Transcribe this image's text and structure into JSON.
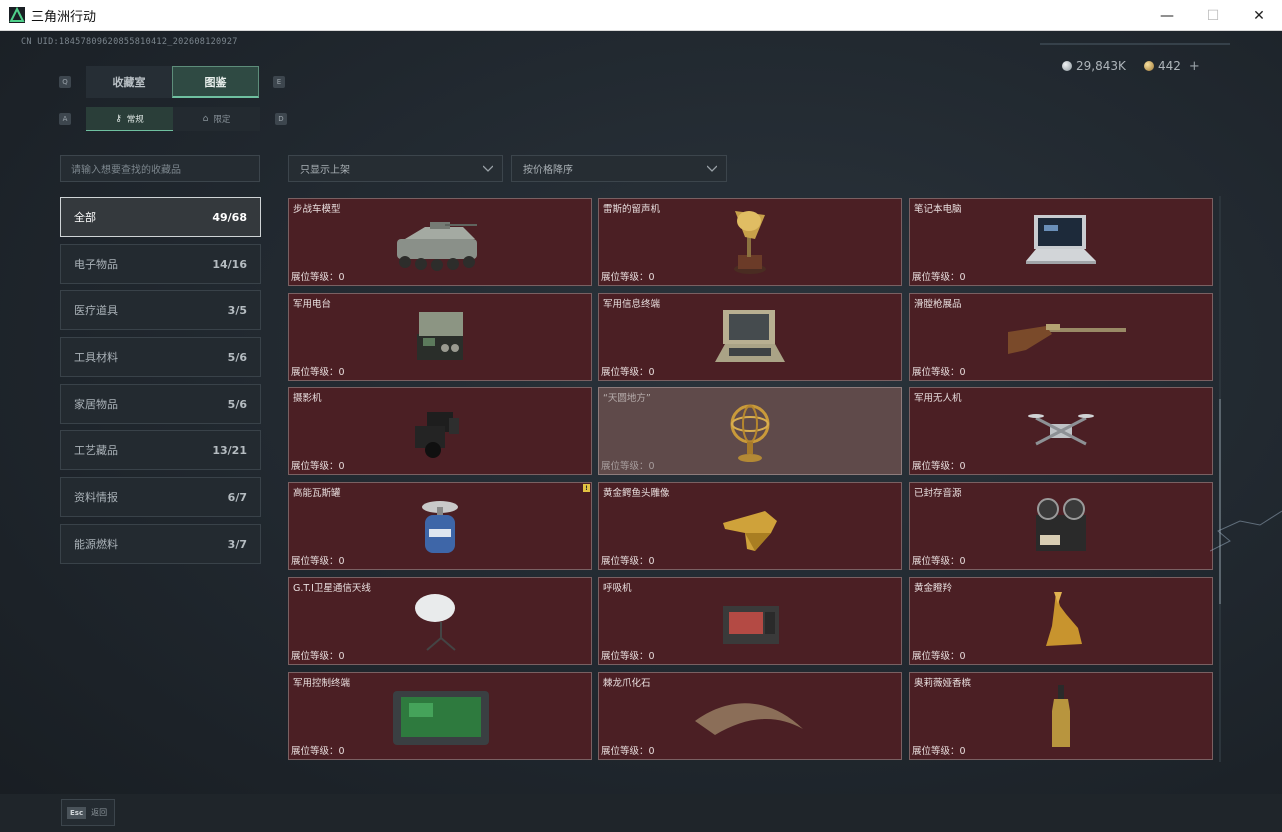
{
  "window": {
    "title": "三角洲行动",
    "min": "—",
    "max": "☐",
    "close": "✕"
  },
  "uid": "CN UID:18457809620855810412_202608120927",
  "currency": [
    {
      "value": "29,843K",
      "color": "#c7cfd3"
    },
    {
      "value": "442",
      "color": "#d9b46a",
      "plus": "+"
    }
  ],
  "keys": {
    "q": "Q",
    "e": "E",
    "a": "A",
    "d": "D"
  },
  "tabs": {
    "collection": "收藏室",
    "codex": "图鉴"
  },
  "subtabs": {
    "normal": "常规",
    "limited": "限定"
  },
  "search_placeholder": "请输入想要查找的收藏品",
  "filters": {
    "shelf": "只显示上架",
    "sort": "按价格降序"
  },
  "categories": [
    {
      "label": "全部",
      "count": "49/68",
      "active": true
    },
    {
      "label": "电子物品",
      "count": "14/16"
    },
    {
      "label": "医疗道具",
      "count": "3/5"
    },
    {
      "label": "工具材料",
      "count": "5/6"
    },
    {
      "label": "家居物品",
      "count": "5/6"
    },
    {
      "label": "工艺藏品",
      "count": "13/21"
    },
    {
      "label": "资料情报",
      "count": "6/7"
    },
    {
      "label": "能源燃料",
      "count": "3/7"
    }
  ],
  "items": [
    {
      "name": "步战车模型",
      "level": "展位等级：0",
      "icon": "ifv-model-icon"
    },
    {
      "name": "雷斯的留声机",
      "level": "展位等级：0",
      "icon": "gramophone-icon"
    },
    {
      "name": "笔记本电脑",
      "level": "展位等级：0",
      "icon": "laptop-icon"
    },
    {
      "name": "军用电台",
      "level": "展位等级：0",
      "icon": "radio-icon"
    },
    {
      "name": "军用信息终端",
      "level": "展位等级：0",
      "icon": "terminal-icon"
    },
    {
      "name": "滑膛枪展品",
      "level": "展位等级：0",
      "icon": "musket-icon"
    },
    {
      "name": "摄影机",
      "level": "展位等级：0",
      "icon": "camera-icon"
    },
    {
      "name": "“天圆地方”",
      "level": "展位等级：0",
      "icon": "armillary-icon",
      "highlight": true
    },
    {
      "name": "军用无人机",
      "level": "展位等级：0",
      "icon": "drone-icon"
    },
    {
      "name": "高能瓦斯罐",
      "level": "展位等级：0",
      "icon": "gas-tank-icon",
      "badge": "!"
    },
    {
      "name": "黄金鳄鱼头雕像",
      "level": "展位等级：0",
      "icon": "croc-head-icon"
    },
    {
      "name": "已封存音源",
      "level": "展位等级：0",
      "icon": "tape-recorder-icon"
    },
    {
      "name": "G.T.I卫星通信天线",
      "level": "展位等级：0",
      "icon": "satellite-dish-icon"
    },
    {
      "name": "呼吸机",
      "level": "展位等级：0",
      "icon": "ventilator-icon"
    },
    {
      "name": "黄金瞪羚",
      "level": "展位等级：0",
      "icon": "gold-gazelle-icon"
    },
    {
      "name": "军用控制终端",
      "level": "展位等级：0",
      "icon": "control-terminal-icon"
    },
    {
      "name": "棘龙爪化石",
      "level": "展位等级：0",
      "icon": "claw-fossil-icon"
    },
    {
      "name": "奥莉薇娅香槟",
      "level": "展位等级：0",
      "icon": "champagne-icon"
    }
  ],
  "footer": {
    "esc": "Esc",
    "back": "返回"
  }
}
